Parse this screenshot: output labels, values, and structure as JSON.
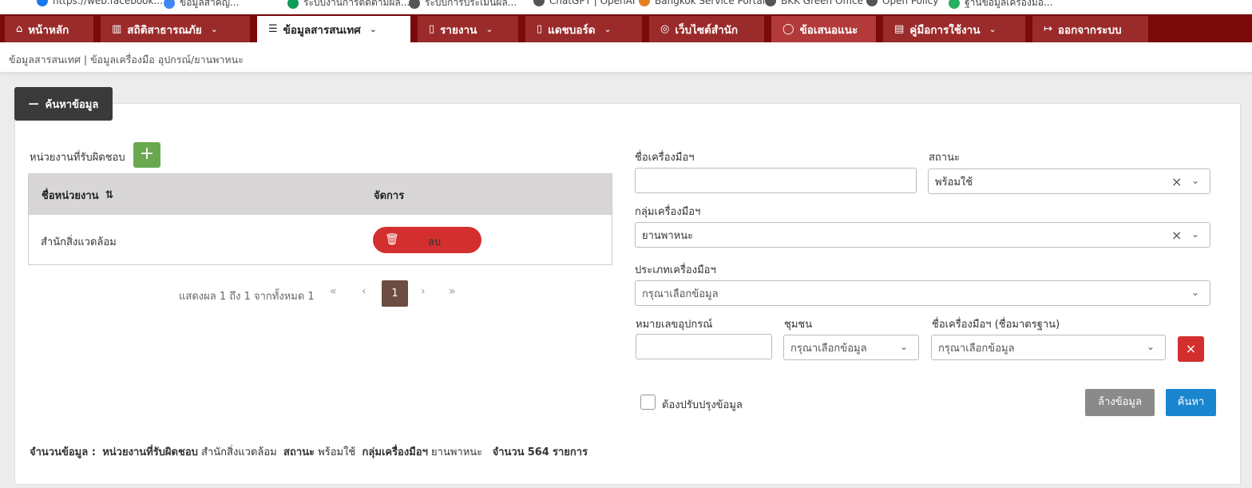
{
  "bookmarks": [
    {
      "label": "https://web.facebook...",
      "color": "#1877f2"
    },
    {
      "label": "ข้อมูลสำคัญ...",
      "color": "#4285f4"
    },
    {
      "label": "ระบบงานการติดตามผล...",
      "color": "#0f9d58"
    },
    {
      "label": "ระบบการประเมินผล...",
      "color": "#555555"
    },
    {
      "label": "ChatGPT | OpenAI",
      "color": "#555555"
    },
    {
      "label": "Bangkok Service Portal",
      "color": "#e67e22"
    },
    {
      "label": "BKK Green Office",
      "color": "#555555"
    },
    {
      "label": "Open Policy",
      "color": "#555555"
    },
    {
      "label": "ฐานข้อมูลเครื่องมือ...",
      "color": "#27ae60"
    }
  ],
  "nav": {
    "items": [
      {
        "icon": "⌂",
        "label": "หน้าหลัก",
        "chev": ""
      },
      {
        "icon": "▥",
        "label": "สถิติสาธารณภัย",
        "chev": "⌄"
      },
      {
        "icon": "☰",
        "label": "ข้อมูลสารสนเทศ",
        "chev": "⌄"
      },
      {
        "icon": "▯",
        "label": "รายงาน",
        "chev": "⌄"
      },
      {
        "icon": "▯",
        "label": "แดชบอร์ด",
        "chev": "⌄"
      },
      {
        "icon": "◎",
        "label": "เว็บไซต์สำนัก",
        "chev": ""
      },
      {
        "icon": "◯",
        "label": "ข้อเสนอแนะ",
        "chev": ""
      },
      {
        "icon": "▤",
        "label": "คู่มือการใช้งาน",
        "chev": "⌄"
      },
      {
        "icon": "↦",
        "label": "ออกจากระบบ",
        "chev": ""
      }
    ]
  },
  "breadcrumb": "ข้อมูลสารสนเทศ | ข้อมูลเครื่องมือ อุปกรณ์/ยานพาหนะ",
  "search_toggle": {
    "icon": "—",
    "label": "ค้นหาข้อมูล"
  },
  "responsible": {
    "label": "หน่วยงานที่รับผิดชอบ",
    "add_icon": "+",
    "columns": {
      "name": "ชื่อหน่วยงาน",
      "sort_icon": "⇅",
      "manage": "จัดการ"
    },
    "rows": [
      {
        "name": "สำนักสิ่งแวดล้อม",
        "delete_label": "ลบ"
      }
    ],
    "pager": {
      "info": "แสดงผล 1 ถึง 1 จากทั้งหมด 1",
      "first": "«",
      "prev": "‹",
      "current": "1",
      "next": "›",
      "last": "»"
    }
  },
  "form": {
    "tool_name": {
      "label": "ชื่อเครื่องมือฯ",
      "value": ""
    },
    "status": {
      "label": "สถานะ",
      "value": "พร้อมใช้"
    },
    "tool_group": {
      "label": "กลุ่มเครื่องมือฯ",
      "value": "ยานพาหนะ"
    },
    "tool_type": {
      "label": "ประเภทเครื่องมือฯ",
      "value": "กรุณาเลือกข้อมูล"
    },
    "equipment_no": {
      "label": "หมายเลขอุปกรณ์",
      "value": ""
    },
    "community": {
      "label": "ชุมชน",
      "value": "กรุณาเลือกข้อมูล"
    },
    "standard_name": {
      "label": "ชื่อเครื่องมือฯ (ชื่อมาตรฐาน)",
      "value": "กรุณาเลือกข้อมูล"
    },
    "clear_x": "×",
    "chev": "⌄",
    "needs_update_label": "ต้องปรับปรุงข้อมูล",
    "btn_clear": "ล้างข้อมูล",
    "btn_search": "ค้นหา"
  },
  "summary": {
    "prefix": "จำนวนข้อมูล :",
    "k1": "หน่วยงานที่รับผิดชอบ",
    "v1": "สำนักสิ่งแวดล้อม",
    "k2": "สถานะ",
    "v2": "พร้อมใช้",
    "k3": "กลุ่มเครื่องมือฯ",
    "v3": "ยานพาหนะ",
    "k4": "จำนวน",
    "v4": "564",
    "unit": "รายการ"
  }
}
